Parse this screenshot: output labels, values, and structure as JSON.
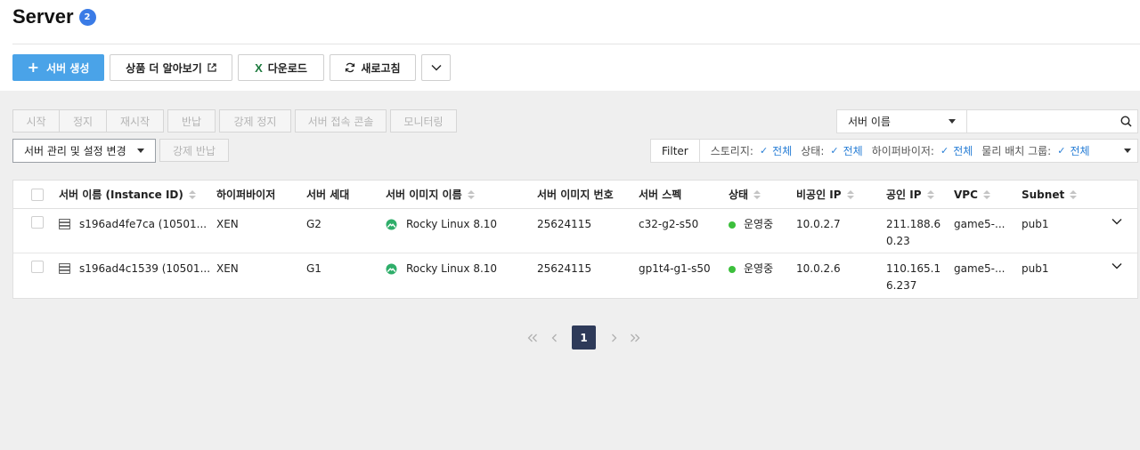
{
  "page": {
    "title": "Server",
    "count": "2"
  },
  "toolbar": {
    "create_label": "서버 생성",
    "learn_more_label": "상품 더 알아보기",
    "download_label": "다운로드",
    "refresh_label": "새로고침"
  },
  "actions": {
    "start": "시작",
    "stop": "정지",
    "restart": "재시작",
    "return": "반납",
    "force_stop": "강제 정지",
    "console": "서버 접속 콘솔",
    "monitoring": "모니터링",
    "manage_settings": "서버 관리 및 설정 변경",
    "force_return": "강제 반납"
  },
  "search": {
    "field_selected": "서버 이름",
    "placeholder": ""
  },
  "filter": {
    "label": "Filter",
    "items": [
      {
        "key": "스토리지:",
        "value": "전체"
      },
      {
        "key": "상태:",
        "value": "전체"
      },
      {
        "key": "하이퍼바이저:",
        "value": "전체"
      },
      {
        "key": "물리 배치 그룹:",
        "value": "전체"
      }
    ]
  },
  "table": {
    "headers": {
      "name": "서버 이름 (Instance ID)",
      "hypervisor": "하이퍼바이저",
      "generation": "서버 세대",
      "image_name": "서버 이미지 이름",
      "image_no": "서버 이미지 번호",
      "spec": "서버 스펙",
      "status": "상태",
      "private_ip": "비공인 IP",
      "public_ip": "공인 IP",
      "vpc": "VPC",
      "subnet": "Subnet"
    },
    "rows": [
      {
        "name": "s196ad4fe7ca (10501...",
        "hypervisor": "XEN",
        "generation": "G2",
        "image_name": "Rocky Linux 8.10",
        "image_no": "25624115",
        "spec": "c32-g2-s50",
        "status": "운영중",
        "private_ip": "10.0.2.7",
        "public_ip_1": "211.188.6",
        "public_ip_2": "0.23",
        "vpc": "game5-...",
        "subnet": "pub1"
      },
      {
        "name": "s196ad4c1539 (10501...",
        "hypervisor": "XEN",
        "generation": "G1",
        "image_name": "Rocky Linux 8.10",
        "image_no": "25624115",
        "spec": "gp1t4-g1-s50",
        "status": "운영중",
        "private_ip": "10.0.2.6",
        "public_ip_1": "110.165.1",
        "public_ip_2": "6.237",
        "vpc": "game5-...",
        "subnet": "pub1"
      }
    ]
  },
  "pagination": {
    "current": "1"
  },
  "colors": {
    "primary": "#4aa3e8",
    "badge": "#3a7be6",
    "status_running": "#3cbf3c",
    "filter_accent": "#2a7fd6",
    "page_current": "#2e3a59"
  },
  "icons": [
    "plus-icon",
    "external-link-icon",
    "excel-icon",
    "refresh-icon",
    "chevron-down-icon",
    "search-icon",
    "check-icon",
    "server-icon",
    "rocky-linux-icon",
    "sort-icon",
    "double-chevron-left-icon",
    "chevron-left-icon",
    "chevron-right-icon",
    "double-chevron-right-icon"
  ]
}
